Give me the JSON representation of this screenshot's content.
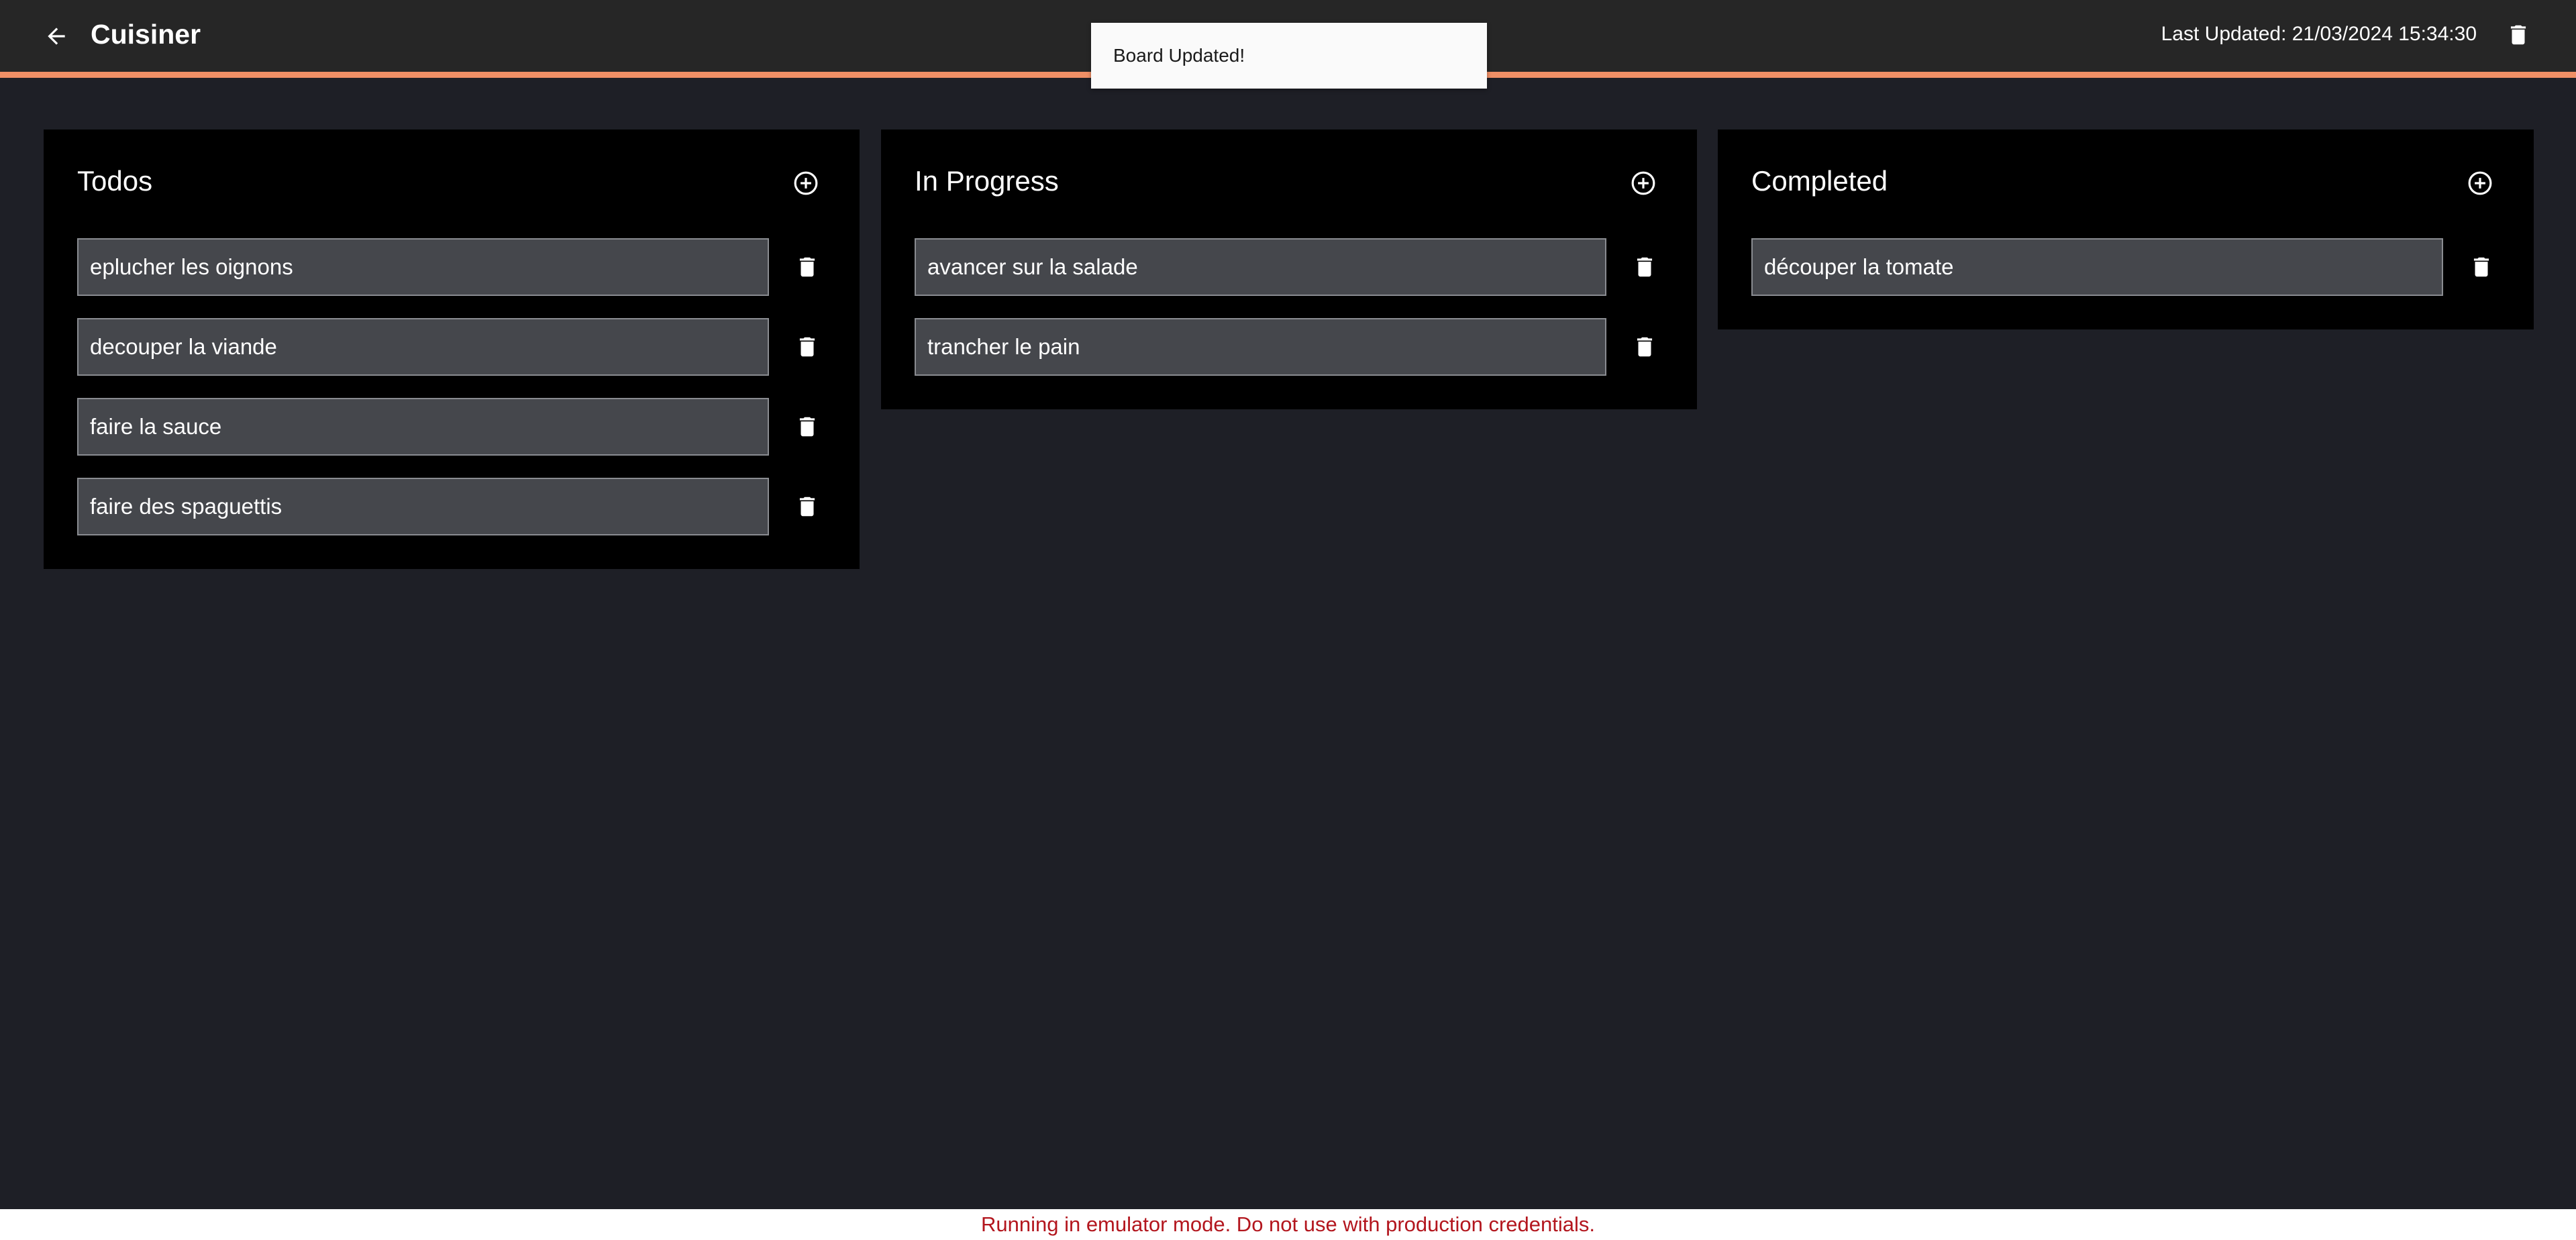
{
  "header": {
    "title": "Cuisiner",
    "last_updated": "Last Updated: 21/03/2024 15:34:30",
    "back_icon": "arrow-left-icon",
    "delete_icon": "trash-icon"
  },
  "toast": {
    "message": "Board Updated!"
  },
  "columns": [
    {
      "title": "Todos",
      "cards": [
        "eplucher les oignons",
        "decouper la viande",
        "faire la sauce",
        "faire des spaguettis"
      ]
    },
    {
      "title": "In Progress",
      "cards": [
        "avancer sur la salade",
        "trancher le pain"
      ]
    },
    {
      "title": "Completed",
      "cards": [
        "découper la tomate"
      ]
    }
  ],
  "footer": {
    "warning": "Running in emulator mode. Do not use with production credentials."
  },
  "colors": {
    "background": "#1e1f26",
    "topbar": "#262626",
    "accent": "#ef8f66",
    "column": "#000000",
    "card": "#45474c",
    "warning_text": "#b3161e"
  }
}
